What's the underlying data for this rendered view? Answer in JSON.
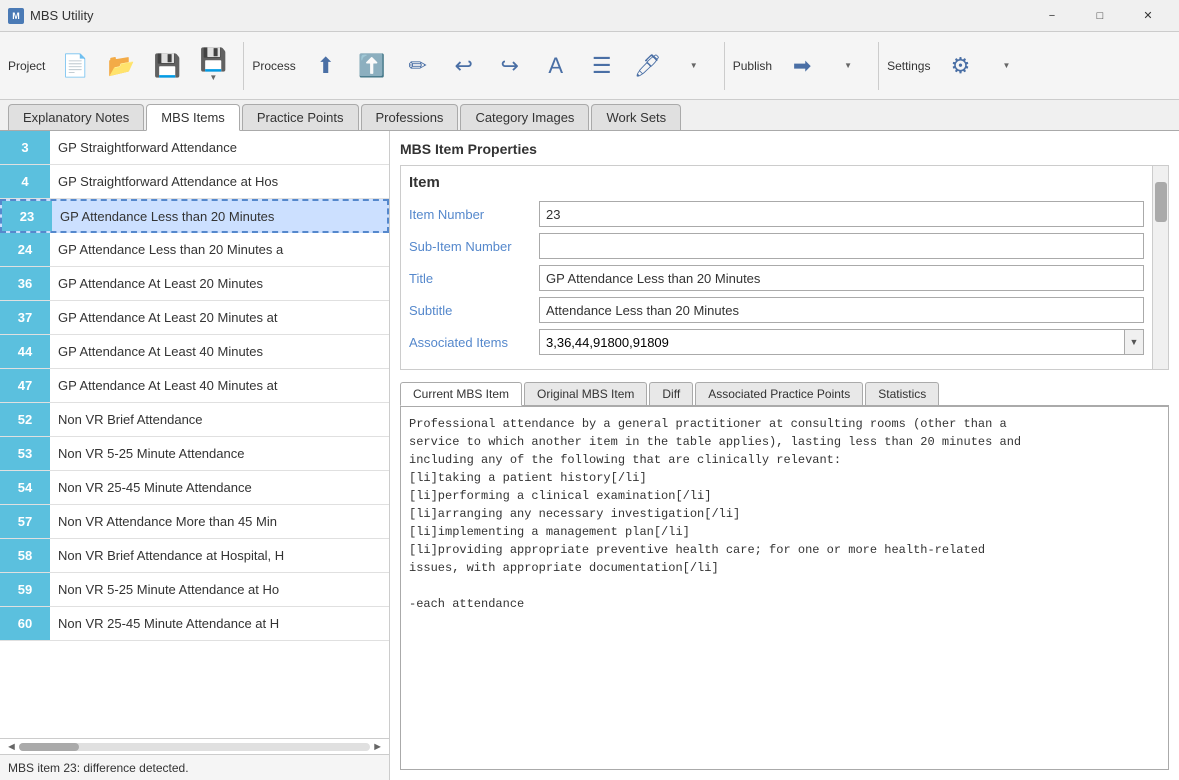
{
  "app": {
    "title": "MBS Utility",
    "icon": "M"
  },
  "toolbar": {
    "project_label": "Project",
    "process_label": "Process",
    "publish_label": "Publish",
    "settings_label": "Settings"
  },
  "tabs": {
    "items": [
      {
        "id": "explanatory-notes",
        "label": "Explanatory Notes",
        "active": false
      },
      {
        "id": "mbs-items",
        "label": "MBS Items",
        "active": true
      },
      {
        "id": "practice-points",
        "label": "Practice Points",
        "active": false
      },
      {
        "id": "professions",
        "label": "Professions",
        "active": false
      },
      {
        "id": "category-images",
        "label": "Category Images",
        "active": false
      },
      {
        "id": "work-sets",
        "label": "Work Sets",
        "active": false
      }
    ]
  },
  "list": {
    "items": [
      {
        "num": "3",
        "label": "GP Straightforward Attendance"
      },
      {
        "num": "4",
        "label": "GP Straightforward Attendance at Hos"
      },
      {
        "num": "23",
        "label": "GP Attendance Less than 20 Minutes",
        "selected": true
      },
      {
        "num": "24",
        "label": "GP Attendance Less than 20 Minutes a"
      },
      {
        "num": "36",
        "label": "GP Attendance At Least 20 Minutes"
      },
      {
        "num": "37",
        "label": "GP Attendance At Least 20 Minutes at"
      },
      {
        "num": "44",
        "label": "GP Attendance At Least 40 Minutes"
      },
      {
        "num": "47",
        "label": "GP Attendance At Least 40 Minutes at"
      },
      {
        "num": "52",
        "label": "Non VR Brief Attendance"
      },
      {
        "num": "53",
        "label": "Non VR 5-25 Minute Attendance"
      },
      {
        "num": "54",
        "label": "Non VR 25-45 Minute Attendance"
      },
      {
        "num": "57",
        "label": "Non VR Attendance More than 45 Min"
      },
      {
        "num": "58",
        "label": "Non VR Brief Attendance at Hospital, H"
      },
      {
        "num": "59",
        "label": "Non VR 5-25 Minute Attendance at Ho"
      },
      {
        "num": "60",
        "label": "Non VR 25-45 Minute Attendance at H"
      }
    ]
  },
  "status_bar": "MBS item 23: difference detected.",
  "properties": {
    "panel_title": "MBS Item Properties",
    "section_title": "Item",
    "item_number_label": "Item Number",
    "item_number_value": "23",
    "sub_item_number_label": "Sub-Item Number",
    "sub_item_number_value": "",
    "title_label": "Title",
    "title_value": "GP Attendance Less than 20 Minutes",
    "subtitle_label": "Subtitle",
    "subtitle_value": "Attendance Less than 20 Minutes",
    "associated_items_label": "Associated Items",
    "associated_items_value": "3,36,44,91800,91809"
  },
  "content_tabs": {
    "items": [
      {
        "id": "current",
        "label": "Current MBS Item",
        "active": true
      },
      {
        "id": "original",
        "label": "Original MBS Item",
        "active": false
      },
      {
        "id": "diff",
        "label": "Diff",
        "active": false
      },
      {
        "id": "practice-points",
        "label": "Associated Practice Points",
        "active": false
      },
      {
        "id": "statistics",
        "label": "Statistics",
        "active": false
      }
    ]
  },
  "text_content": "Professional attendance by a general practitioner at consulting rooms (other than a\nservice to which another item in the table applies), lasting less than 20 minutes and\nincluding any of the following that are clinically relevant:\n[li]taking a patient history[/li]\n[li]performing a clinical examination[/li]\n[li]arranging any necessary investigation[/li]\n[li]implementing a management plan[/li]\n[li]providing appropriate preventive health care; for one or more health-related\nissues, with appropriate documentation[/li]\n\n-each attendance"
}
